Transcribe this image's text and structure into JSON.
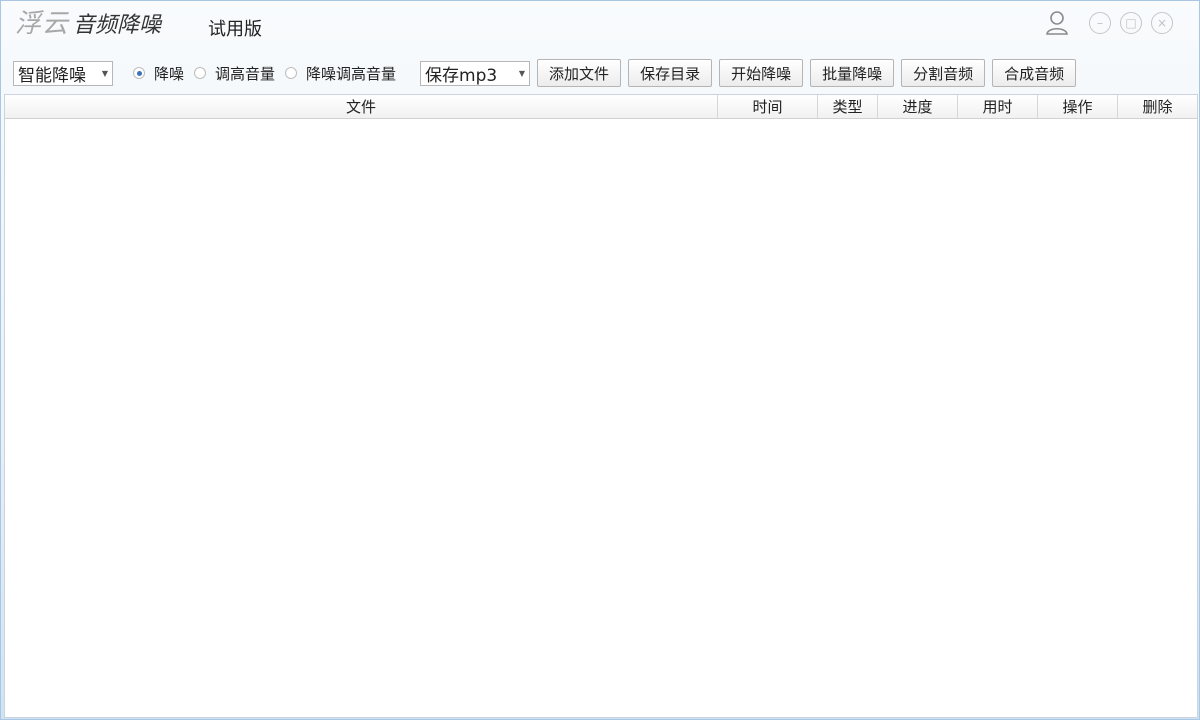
{
  "app": {
    "brand": "浮云",
    "product": "音频降噪",
    "edition": "试用版"
  },
  "window_controls": {
    "user": "user-icon",
    "minimize": "–",
    "maximize": "□",
    "close": "×"
  },
  "toolbar": {
    "mode_select": {
      "value": "智能降噪"
    },
    "radios": [
      {
        "label": "降噪",
        "checked": true
      },
      {
        "label": "调高音量",
        "checked": false
      },
      {
        "label": "降噪调高音量",
        "checked": false
      }
    ],
    "format_select": {
      "value": "保存mp3"
    },
    "buttons": {
      "add_file": "添加文件",
      "save_dir": "保存目录",
      "start": "开始降噪",
      "batch": "批量降噪",
      "split": "分割音频",
      "merge": "合成音频"
    }
  },
  "table": {
    "columns": {
      "file": "文件",
      "time": "时间",
      "type": "类型",
      "progress": "进度",
      "elapsed": "用时",
      "action": "操作",
      "delete": "删除"
    },
    "rows": []
  },
  "colors": {
    "accent": "#3a73b8",
    "border": "#a9c6e3"
  }
}
